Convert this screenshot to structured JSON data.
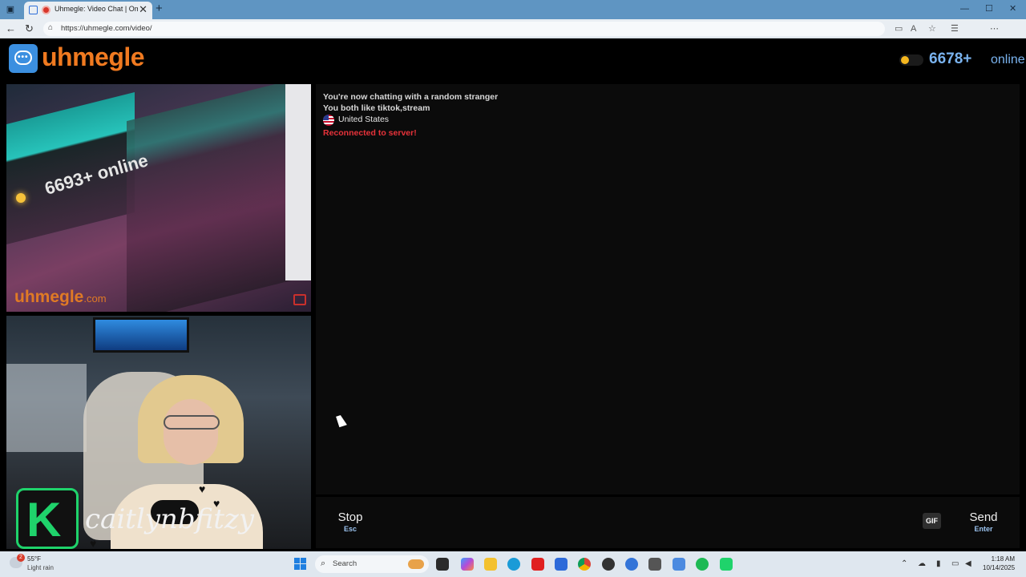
{
  "browser": {
    "tab_title": "Uhmegle: Video Chat | Omeg",
    "tab_close": "✕",
    "new_tab": "+",
    "url": "https://uhmegle.com/video/",
    "minimize": "—",
    "maximize": "☐",
    "close": "✕"
  },
  "site": {
    "logo_text": "uhmegle",
    "online_count": "6678+",
    "online_label": "online"
  },
  "stranger_video": {
    "overlay_count": "6693+ online",
    "watermark": "uhmegle",
    "watermark_suffix": ".com"
  },
  "self_video": {
    "badge_letter": "K",
    "streamer_name": "caitlynbfitzy"
  },
  "chat": {
    "line1": "You're now chatting with a random stranger",
    "line2": "You both like tiktok,stream",
    "country": "United States",
    "status": "Reconnected to server!"
  },
  "controls": {
    "stop_label": "Stop",
    "stop_key": "Esc",
    "message_value": "",
    "gif_label": "GIF",
    "send_label": "Send",
    "send_key": "Enter"
  },
  "taskbar": {
    "weather_badge": "2",
    "weather_temp": "55°F",
    "weather_desc": "Light rain",
    "search_placeholder": "Search",
    "time": "1:18 AM",
    "date": "10/14/2025"
  },
  "colors": {
    "accent_orange": "#f07a20",
    "online_blue": "#7ab3ef",
    "error_red": "#e8323a",
    "logo_blue": "#3b8fe0"
  }
}
